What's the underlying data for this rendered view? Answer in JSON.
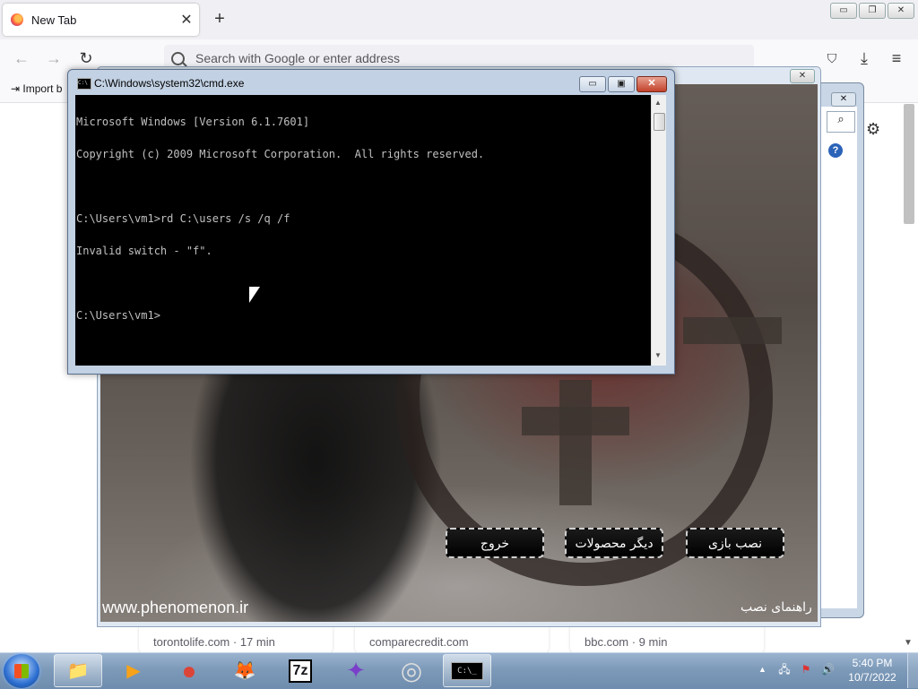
{
  "firefox": {
    "tab_title": "New Tab",
    "tab_close": "✕",
    "new_tab": "+",
    "url_placeholder": "Search with Google or enter address",
    "import_label": "Import b",
    "back": "←",
    "forward": "→",
    "reload": "↻",
    "pocket": "⛉",
    "download": "⤓",
    "menu": "≡",
    "settings": "⚙",
    "win_min": "▭",
    "win_max": "❐",
    "win_close": "✕",
    "shortcuts": [
      {
        "label": "torontolife.com · 17 min"
      },
      {
        "label": "comparecredit.com"
      },
      {
        "label": "bbc.com · 9 min"
      }
    ]
  },
  "installer": {
    "close": "✕",
    "buttons": {
      "exit": "خروج",
      "other_products": "دیگر محصولات",
      "install_game": "نصب بازی"
    },
    "website": "www.phenomenon.ir",
    "guide": "راهنمای نصب"
  },
  "cmd": {
    "title": "C:\\Windows\\system32\\cmd.exe",
    "minimize": "▭",
    "maximize": "▣",
    "close": "✕",
    "lines": [
      "Microsoft Windows [Version 6.1.7601]",
      "Copyright (c) 2009 Microsoft Corporation.  All rights reserved.",
      "",
      "C:\\Users\\vm1>rd C:\\users /s /q /f",
      "Invalid switch - \"f\".",
      "",
      "C:\\Users\\vm1>"
    ]
  },
  "taskbar": {
    "apps": [
      {
        "name": "windows-explorer",
        "glyph": "📁",
        "active": true
      },
      {
        "name": "media-player",
        "glyph": "▶",
        "active": false
      },
      {
        "name": "chrome",
        "glyph": "●",
        "active": false
      },
      {
        "name": "firefox",
        "glyph": "🦊",
        "active": false
      },
      {
        "name": "7zip",
        "glyph": "7z",
        "active": false
      },
      {
        "name": "vlc-like",
        "glyph": "✦",
        "active": false
      },
      {
        "name": "disc-burner",
        "glyph": "◎",
        "active": false
      },
      {
        "name": "cmd",
        "glyph": "C:\\_",
        "active": true
      }
    ],
    "clock_time": "5:40 PM",
    "clock_date": "10/7/2022",
    "tray_up": "▲"
  }
}
